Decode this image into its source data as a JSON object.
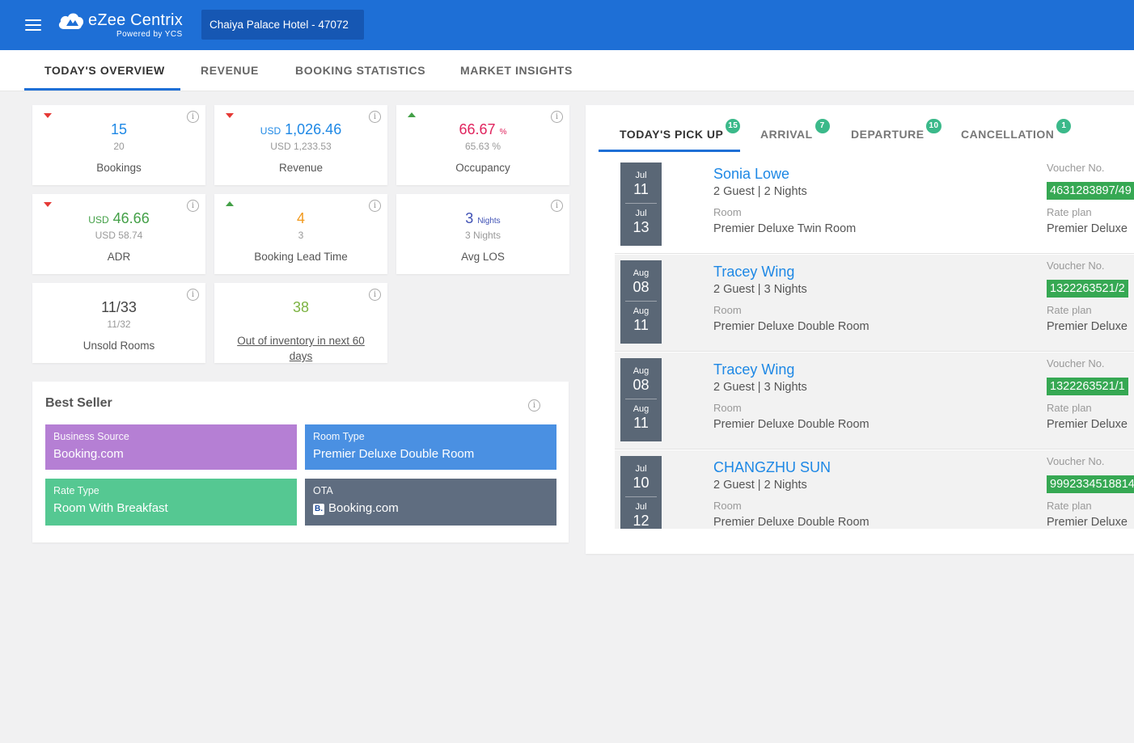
{
  "app": {
    "logo_name": "eZee Centrix",
    "logo_sub": "Powered by YCS",
    "hotel": "Chaiya Palace Hotel -  47072"
  },
  "tabs": [
    "TODAY'S OVERVIEW",
    "REVENUE",
    "BOOKING STATISTICS",
    "MARKET INSIGHTS"
  ],
  "kpis": {
    "bookings": {
      "value": "15",
      "prev": "20",
      "label": "Bookings",
      "trend": "down"
    },
    "revenue": {
      "currency": "USD",
      "value": "1,026.46",
      "prev": "USD 1,233.53",
      "label": "Revenue",
      "trend": "down"
    },
    "occupancy": {
      "value": "66.67",
      "unit": "%",
      "prev": "65.63 %",
      "label": "Occupancy",
      "trend": "up"
    },
    "adr": {
      "currency": "USD",
      "value": "46.66",
      "prev": "USD 58.74",
      "label": "ADR",
      "trend": "down"
    },
    "lead_time": {
      "value": "4",
      "prev": "3",
      "label": "Booking Lead Time",
      "trend": "up"
    },
    "avg_los": {
      "value": "3",
      "unit": "Nights",
      "prev": "3 Nights",
      "label": "Avg LOS"
    },
    "unsold": {
      "value": "11/33",
      "prev": "11/32",
      "label": "Unsold Rooms"
    },
    "out_of_inventory": {
      "value": "38",
      "label": "Out of inventory in next 60 days"
    }
  },
  "best_seller": {
    "title": "Best Seller",
    "business_source": {
      "label": "Business Source",
      "value": "Booking.com"
    },
    "room_type": {
      "label": "Room Type",
      "value": "Premier Deluxe Double Room"
    },
    "rate_type": {
      "label": "Rate Type",
      "value": "Room With Breakfast"
    },
    "ota": {
      "label": "OTA",
      "badge": "B.",
      "value": "Booking.com"
    }
  },
  "right_tabs": [
    {
      "label": "TODAY'S PICK UP",
      "count": "15"
    },
    {
      "label": "ARRIVAL",
      "count": "7"
    },
    {
      "label": "DEPARTURE",
      "count": "10"
    },
    {
      "label": "CANCELLATION",
      "count": "1"
    }
  ],
  "field_labels": {
    "room": "Room",
    "voucher": "Voucher No.",
    "rate_plan": "Rate plan"
  },
  "bookings": [
    {
      "in_month": "Jul",
      "in_day": "11",
      "out_month": "Jul",
      "out_day": "13",
      "name": "Sonia Lowe",
      "info": "2 Guest | 2 Nights",
      "room": "Premier Deluxe Twin Room",
      "voucher": "4631283897/49",
      "rate_plan": "Premier Deluxe"
    },
    {
      "in_month": "Aug",
      "in_day": "08",
      "out_month": "Aug",
      "out_day": "11",
      "name": "Tracey Wing",
      "info": "2 Guest | 3 Nights",
      "room": "Premier Deluxe Double Room",
      "voucher": "1322263521/2",
      "rate_plan": "Premier Deluxe"
    },
    {
      "in_month": "Aug",
      "in_day": "08",
      "out_month": "Aug",
      "out_day": "11",
      "name": "Tracey Wing",
      "info": "2 Guest | 3 Nights",
      "room": "Premier Deluxe Double Room",
      "voucher": "1322263521/1",
      "rate_plan": "Premier Deluxe"
    },
    {
      "in_month": "Jul",
      "in_day": "10",
      "out_month": "Jul",
      "out_day": "12",
      "name": "CHANGZHU SUN",
      "info": "2 Guest | 2 Nights",
      "room": "Premier Deluxe Double Room",
      "voucher": "9992334518814",
      "rate_plan": "Premier Deluxe"
    }
  ],
  "colors": {
    "topbar": "#1e6fd6",
    "tile_business_source": "#b57fd4",
    "tile_room_type": "#4a90e2",
    "tile_rate_type": "#55c892",
    "tile_ota": "#5f6d80",
    "voucher": "#36a853"
  }
}
